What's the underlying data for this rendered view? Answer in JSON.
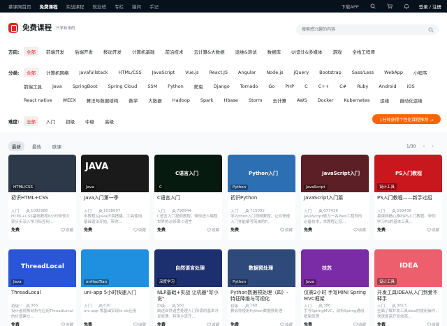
{
  "topnav": {
    "links": [
      "慕课网首页",
      "免费课程",
      "实战课程",
      "就业班",
      "专栏",
      "猿问",
      "手记"
    ],
    "download": "下载APP",
    "login": "登录 / 注册"
  },
  "header": {
    "brand": "免费课程",
    "slogan": "只学有用的",
    "search_placeholder": "搜索感兴趣的内容",
    "direction": {
      "label": "方向:",
      "tags": [
        "全部",
        "前端开发",
        "后端开发",
        "移动开发",
        "计算机基础",
        "前沿技术",
        "云计算&大数据",
        "运维&测试",
        "数据库",
        "UI设计&多媒体",
        "游戏",
        "全栈工程师"
      ]
    },
    "category": {
      "label": "分类:",
      "rows": [
        [
          "全部",
          "计算机网络",
          "Javafullstack",
          "HTML/CSS",
          "JavaScript",
          "Vue.js",
          "React.JS",
          "Angular",
          "Node.js",
          "jQuery",
          "Bootstrap",
          "Sass/Less",
          "WebApp",
          "小程序"
        ],
        [
          "前端工具",
          "Java",
          "SpringBoot",
          "Spring Cloud",
          "SSM",
          "Python",
          "爬虫",
          "Django",
          "Tornado",
          "Go",
          "PHP",
          "C",
          "C++",
          "C#",
          "Ruby",
          "Android",
          "iOS"
        ],
        [
          "React native",
          "WEEX",
          "算法与数据结构",
          "数学",
          "大数据",
          "Hadoop",
          "Spark",
          "Hbase",
          "Storm",
          "云计算",
          "AWS",
          "Docker",
          "Kubernetes",
          "运维",
          "自动化运维"
        ]
      ]
    },
    "difficulty": {
      "label": "难度:",
      "tags": [
        "全部",
        "入门",
        "初级",
        "中级",
        "高级"
      ]
    },
    "promo_button": "1分钟获得个性化课程推荐 →"
  },
  "sort": {
    "tabs": [
      "最新",
      "最热",
      "欧课"
    ],
    "page": "1/30",
    "prev": "‹",
    "next": "›"
  },
  "cards": [
    {
      "chip": "HTML/CSS",
      "title": "初识HTML+CSS",
      "level": "入门",
      "count": "1092988",
      "desc": "HTML+CSS基础教程8小时带领大家步步深入学习标签用...",
      "price": "免费",
      "fav": "收藏",
      "bg": "#2d3848",
      "thumb_text": ""
    },
    {
      "chip": "Java",
      "title": "Java入门第一季",
      "level": "入门",
      "count": "1038607",
      "desc": "本教程从Java环境搭建、工具使用、基础语法开始，带你...",
      "price": "免费",
      "fav": "收藏",
      "bg": "#1a1a1a",
      "thumb_text": "JAVA"
    },
    {
      "chip": "C",
      "title": "C语言入门",
      "level": "入门",
      "count": "796944",
      "desc": "C语言入门视频教程，带你进入编程世界的必修课-C语言",
      "price": "免费",
      "fav": "收藏",
      "bg": "#061a10",
      "thumb_text": "C语言入门"
    },
    {
      "chip": "Python",
      "title": "初识Python",
      "level": "入门",
      "count": "715092",
      "desc": "学Python入门视频教程，让你快速入门并能编写简单的P...",
      "price": "免费",
      "fav": "收藏",
      "bg": "#2d6fb3",
      "thumb_text": "Python入门"
    },
    {
      "chip": "JavaScript",
      "title": "JavaScript入门篇",
      "level": "入门",
      "count": "677436",
      "desc": "JavaScript做为一名Web工程师的必备技术，本教程让您...",
      "price": "免费",
      "fav": "收藏",
      "bg": "#5b1f25",
      "thumb_text": "JavaScript入门"
    },
    {
      "chip": "设计工具",
      "title": "PS入门教程——新手过招",
      "level": "入门",
      "count": "593436",
      "desc": "慕课网精心推出PS入门教程，带你学习PS的基本工具...",
      "price": "免费",
      "fav": "收藏",
      "bg": "#c8181e",
      "thumb_text": "PS入门教程"
    },
    {
      "chip": "Java",
      "title": "ThreadLocal",
      "level": "初级",
      "count": "365",
      "desc": "设计者视角剖析与应用ThreadLocal的价值建立...",
      "price": "免费",
      "fav": "收藏",
      "bg": "#2a55d6",
      "thumb_text": "ThreadLocal"
    },
    {
      "chip": "mrHaoTian",
      "title": "uni-app 5小时快速入门",
      "level": "入门",
      "count": "610",
      "desc": "uni-app 零基础实现to-do应用",
      "price": "免费",
      "fav": "收藏",
      "bg": "#1f8fe0",
      "thumb_text": ""
    },
    {
      "chip": "深度学习",
      "title": "NLP基础+实战 让机器\"写小说\"",
      "level": "中级",
      "count": "560",
      "desc": "阐述自然语言处理入门所需的基本开发原理，利用主流开...",
      "price": "免费",
      "fav": "收藏",
      "bg": "#1c2f6e",
      "thumb_text": "自然语言处理"
    },
    {
      "chip": "Python",
      "title": "Python数据预处理（四）- 特征降维与可视化",
      "level": "初级",
      "count": "768",
      "desc": "教会你使用Python数据预处理",
      "price": "免费",
      "fav": "收藏",
      "bg": "#2e4a7a",
      "thumb_text": "数据预处理"
    },
    {
      "chip": "Java",
      "title": "仅需2小时 手写MINI Spring MVC框架",
      "level": "入门",
      "count": "386",
      "desc": "手写SpringMVC，剖析Spring通用框架原理",
      "price": "免费",
      "fav": "收藏",
      "bg": "#7a2ba6",
      "thumb_text": "扶苏"
    },
    {
      "chip": "设计工具",
      "title": "开发工具IDEA从入门到爱不释手",
      "level": "入门",
      "count": "3813",
      "desc": "全面了解并发工具idea的使用操作，快速提高开发效率...",
      "price": "免费",
      "fav": "收藏",
      "bg": "#ee5f6e",
      "thumb_text": "IDEA"
    }
  ]
}
